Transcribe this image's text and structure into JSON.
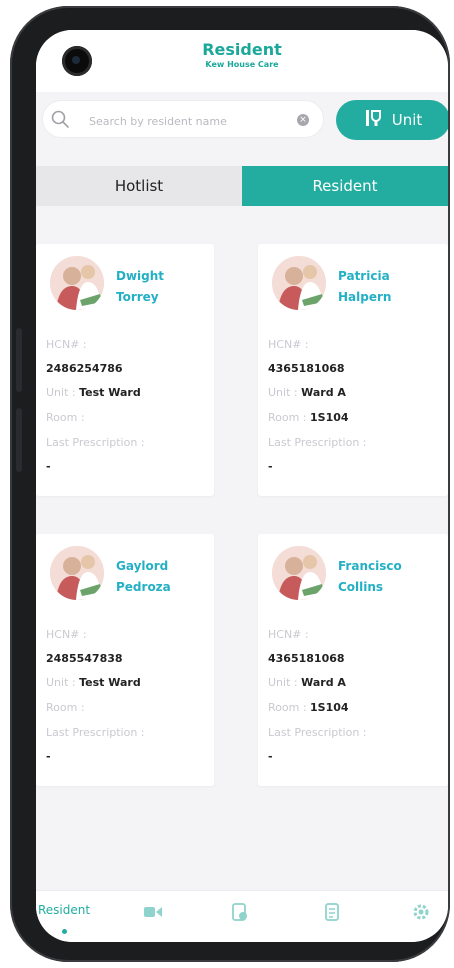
{
  "header": {
    "title": "Resident",
    "subtitle": "Kew House Care"
  },
  "search": {
    "placeholder": "Search by resident name",
    "value": ""
  },
  "unit_button": {
    "label": "Unit"
  },
  "tabs": [
    {
      "label": "Hotlist",
      "active": false
    },
    {
      "label": "Resident",
      "active": true
    }
  ],
  "labels": {
    "hcn": "HCN# :",
    "unit": "Unit :",
    "room": "Room :",
    "last_prescription": "Last Prescription :"
  },
  "residents": [
    {
      "first": "Dwight",
      "last": "Torrey",
      "hcn": "2486254786",
      "unit": "Test Ward",
      "room": "",
      "last_prescription": "-"
    },
    {
      "first": "Patricia",
      "last": "Halpern",
      "hcn": "4365181068",
      "unit": "Ward A",
      "room": "1S104",
      "last_prescription": "-"
    },
    {
      "first": "Gaylord",
      "last": "Pedroza",
      "hcn": "2485547838",
      "unit": "Test Ward",
      "room": "",
      "last_prescription": "-"
    },
    {
      "first": "Francisco",
      "last": "Collins",
      "hcn": "4365181068",
      "unit": "Ward A",
      "room": "1S104",
      "last_prescription": "-"
    }
  ],
  "bottom_nav": {
    "items": [
      {
        "label": "Resident",
        "icon": "resident-icon",
        "active": true
      },
      {
        "label": "",
        "icon": "video-icon",
        "active": false
      },
      {
        "label": "",
        "icon": "document-icon",
        "active": false
      },
      {
        "label": "",
        "icon": "report-icon",
        "active": false
      },
      {
        "label": "",
        "icon": "settings-icon",
        "active": false
      }
    ]
  },
  "colors": {
    "accent": "#23ada0",
    "name_text": "#24b0c4",
    "muted": "#c9cad0"
  }
}
